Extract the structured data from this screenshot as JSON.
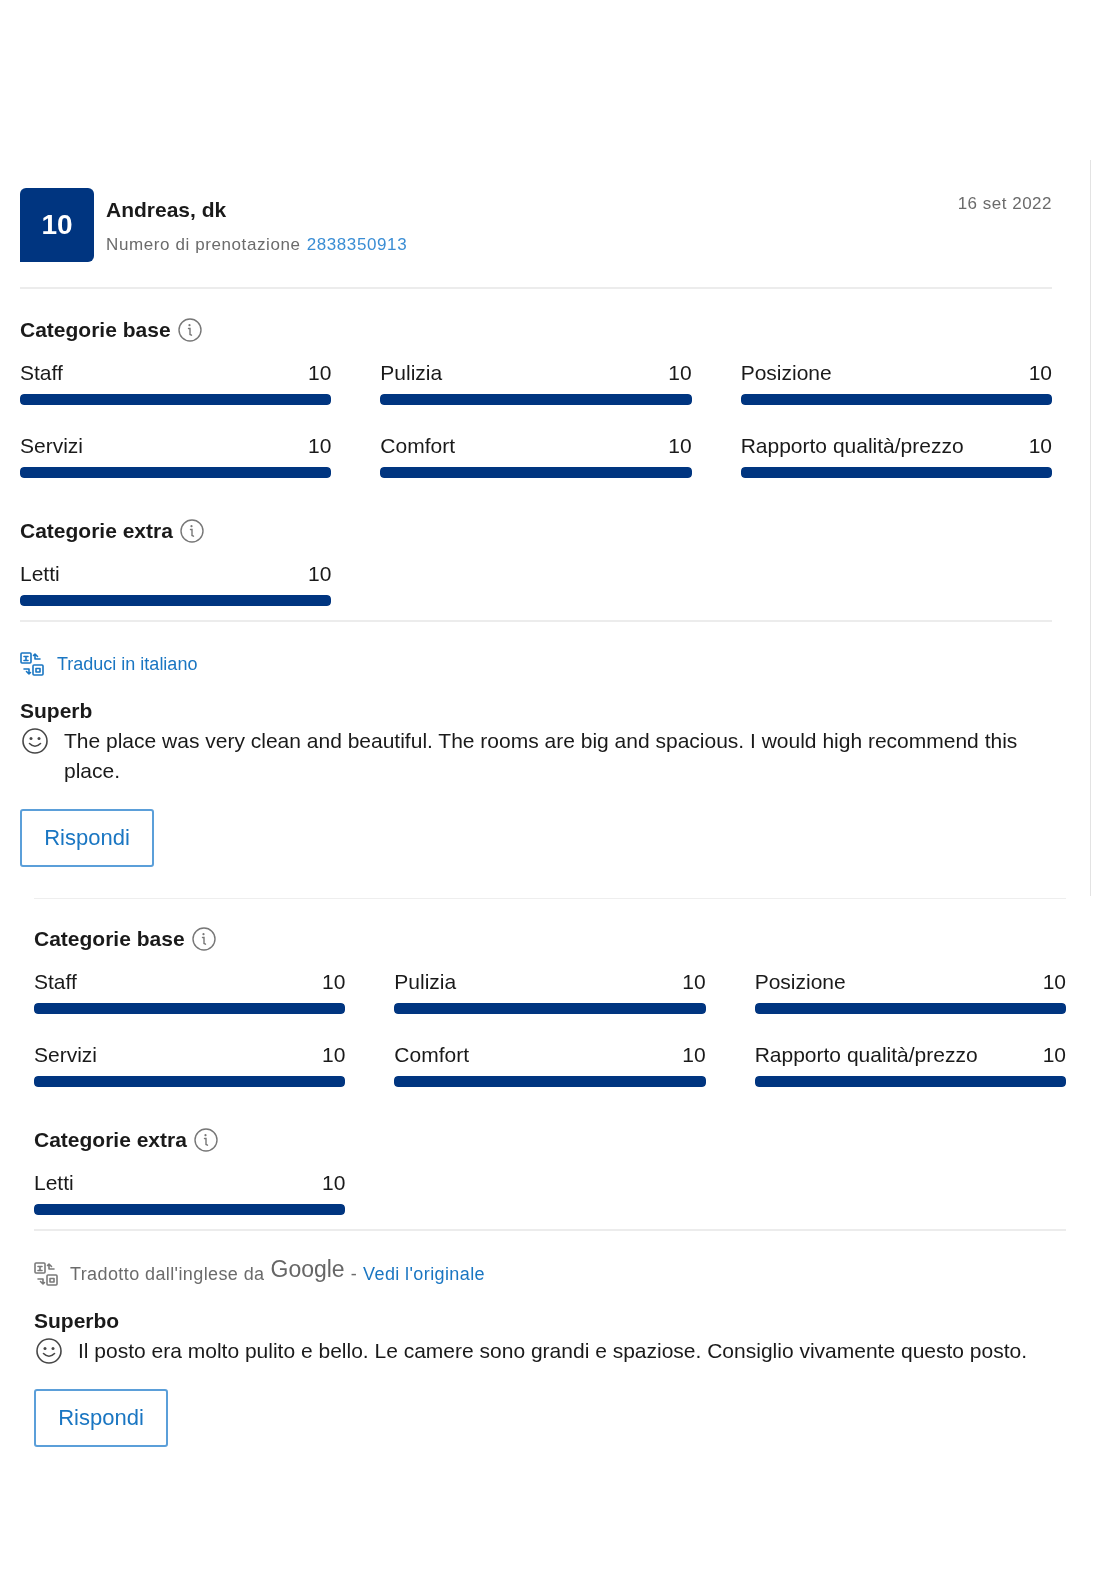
{
  "reviews": [
    {
      "header": {
        "score": "10",
        "reviewer": "Andreas, dk",
        "booking_label": "Numero di prenotazione",
        "booking_number": "2838350913",
        "date": "16 set 2022"
      },
      "category_groups": [
        {
          "title": "Categorie base",
          "items": [
            {
              "label": "Staff",
              "score": "10",
              "level": 1
            },
            {
              "label": "Pulizia",
              "score": "10",
              "level": 1
            },
            {
              "label": "Posizione",
              "score": "10",
              "level": 1
            },
            {
              "label": "Servizi",
              "score": "10",
              "level": 1
            },
            {
              "label": "Comfort",
              "score": "10",
              "level": 1
            },
            {
              "label": "Rapporto qualità/prezzo",
              "score": "10",
              "level": 1
            }
          ]
        },
        {
          "title": "Categorie extra",
          "items": [
            {
              "label": "Letti",
              "score": "10",
              "level": 1
            }
          ]
        }
      ],
      "translation": {
        "kind": "action",
        "link": "Traduci in italiano"
      },
      "title": "Superb",
      "text": "The place was very clean and beautiful. The rooms are big and spacious. I would high recommend this place.",
      "reply_button": "Rispondi"
    },
    {
      "category_groups": [
        {
          "title": "Categorie base",
          "items": [
            {
              "label": "Staff",
              "score": "10",
              "level": 1
            },
            {
              "label": "Pulizia",
              "score": "10",
              "level": 1
            },
            {
              "label": "Posizione",
              "score": "10",
              "level": 1
            },
            {
              "label": "Servizi",
              "score": "10",
              "level": 1
            },
            {
              "label": "Comfort",
              "score": "10",
              "level": 1
            },
            {
              "label": "Rapporto qualità/prezzo",
              "score": "10",
              "level": 1
            }
          ]
        },
        {
          "title": "Categorie extra",
          "items": [
            {
              "label": "Letti",
              "score": "10",
              "level": 1
            }
          ]
        }
      ],
      "translation": {
        "kind": "note",
        "note": "Tradotto dall'inglese da",
        "provider": "Google",
        "separator": "-",
        "link": "Vedi l'originale"
      },
      "title": "Superbo",
      "text": "Il posto era molto pulito e bello. Le camere sono grandi e spaziose. Consiglio vivamente questo posto.",
      "reply_button": "Rispondi"
    }
  ]
}
